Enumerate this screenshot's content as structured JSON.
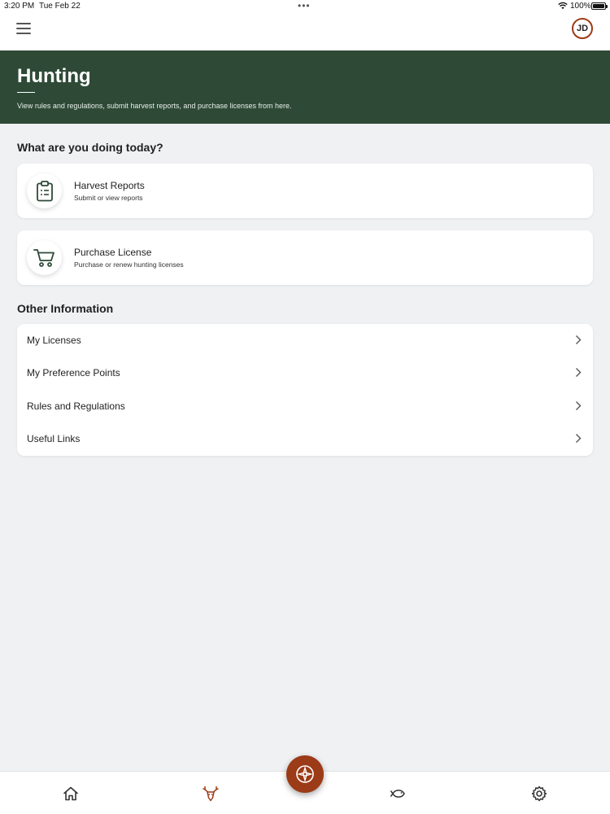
{
  "status_bar": {
    "time": "3:20 PM",
    "date": "Tue Feb 22",
    "battery": "100%"
  },
  "header": {
    "avatar_initials": "JD"
  },
  "hero": {
    "title": "Hunting",
    "subtitle": "View rules and regulations, submit harvest reports, and purchase licenses from here."
  },
  "actions": {
    "section_title": "What are you doing today?",
    "items": [
      {
        "title": "Harvest Reports",
        "subtitle": "Submit or view reports",
        "icon": "clipboard-icon"
      },
      {
        "title": "Purchase License",
        "subtitle": "Purchase or renew hunting licenses",
        "icon": "cart-icon"
      }
    ]
  },
  "other_info": {
    "section_title": "Other Information",
    "items": [
      {
        "label": "My Licenses"
      },
      {
        "label": "My Preference Points"
      },
      {
        "label": "Rules and Regulations"
      },
      {
        "label": "Useful Links"
      }
    ]
  },
  "bottom_nav": {
    "tabs": [
      "home-icon",
      "deer-icon",
      "fish-icon",
      "gear-icon"
    ],
    "fab_icon": "compass-icon"
  },
  "colors": {
    "hero_bg": "#2e4a37",
    "accent": "#9c3b17",
    "page_bg": "#f0f1f3"
  }
}
